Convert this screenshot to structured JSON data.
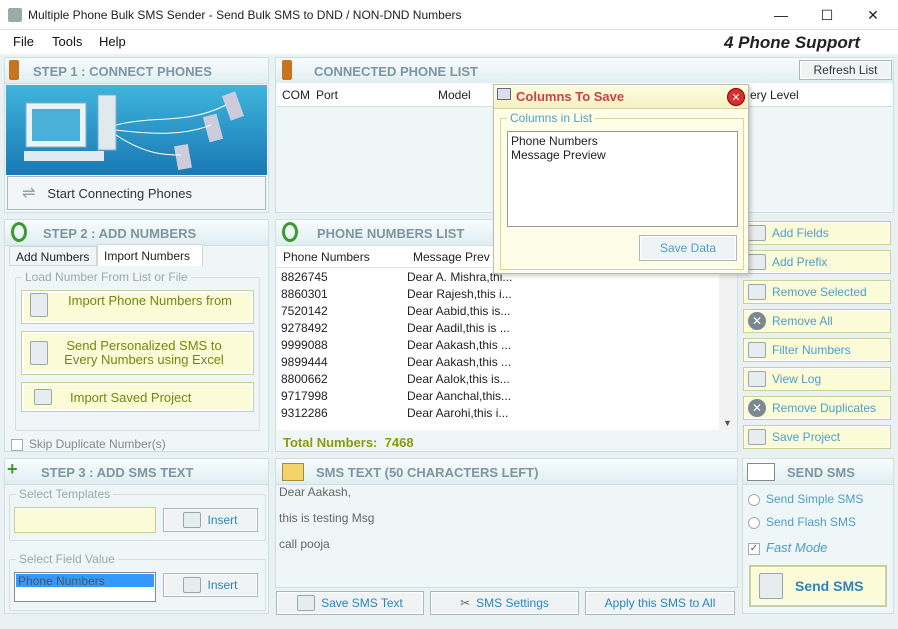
{
  "window": {
    "title": "Multiple Phone Bulk SMS Sender - Send Bulk SMS to DND / NON-DND Numbers",
    "minimize": "—",
    "maximize": "☐",
    "close": "✕"
  },
  "menu": {
    "file": "File",
    "tools": "Tools",
    "help": "Help",
    "support": "4 Phone Support"
  },
  "step1": {
    "title": "STEP 1 : CONNECT PHONES",
    "start_btn": "Start Connecting Phones"
  },
  "connected": {
    "title": "CONNECTED PHONE LIST",
    "refresh": "Refresh List",
    "col_com": "COM",
    "col_port": "Port",
    "col_model": "Model",
    "col_battery": "ery Level"
  },
  "dialog": {
    "title": "Columns To Save",
    "group": "Columns in List",
    "items": [
      "Phone Numbers",
      "Message Preview"
    ],
    "save": "Save Data"
  },
  "step2": {
    "title": "STEP 2 : ADD NUMBERS",
    "tab1": "Add Numbers",
    "tab2": "Import Numbers",
    "group": "Load Number From List or File",
    "btn_import": "Import Phone Numbers from",
    "btn_excel": "Send Personalized SMS to Every Numbers using Excel",
    "btn_project": "Import Saved Project",
    "skip": "Skip Duplicate Number(s)"
  },
  "numbers": {
    "title": "PHONE NUMBERS LIST",
    "col1": "Phone Numbers",
    "col2": "Message Prev",
    "rows": [
      [
        "8826745",
        "Dear A. Mishra,thi..."
      ],
      [
        "8860301",
        "Dear Rajesh,this i..."
      ],
      [
        "7520142",
        "Dear Aabid,this is..."
      ],
      [
        "9278492",
        "Dear Aadil,this is ..."
      ],
      [
        "9999088",
        "Dear Aakash,this ..."
      ],
      [
        "9899444",
        "Dear Aakash,this ..."
      ],
      [
        "8800662",
        "Dear Aalok,this is..."
      ],
      [
        "9717998",
        "Dear Aanchal,this..."
      ],
      [
        "9312286",
        "Dear Aarohi,this i..."
      ]
    ],
    "total_label": "Total Numbers:",
    "total": "7468"
  },
  "side": {
    "add_fields": "Add Fields",
    "add_prefix": "Add Prefix",
    "remove_selected": "Remove Selected",
    "remove_all": "Remove All",
    "filter": "Filter Numbers",
    "view_log": "View Log",
    "remove_dup": "Remove Duplicates",
    "save_project": "Save Project"
  },
  "step3": {
    "title": "STEP 3 : ADD SMS TEXT",
    "templates": "Select Templates",
    "insert": "Insert",
    "field_group": "Select Field Value",
    "field_value": "Phone Numbers",
    "insert2": "Insert"
  },
  "smstext": {
    "title": "SMS TEXT (50 CHARACTERS LEFT)",
    "line1": "Dear Aakash,",
    "line2": "this is testing Msg",
    "line3": "call pooja",
    "save": "Save SMS Text",
    "settings": "SMS Settings",
    "apply": "Apply this SMS to All"
  },
  "send": {
    "title": "SEND SMS",
    "simple": "Send Simple SMS",
    "flash": "Send Flash SMS",
    "fast": "Fast Mode",
    "btn": "Send SMS"
  }
}
